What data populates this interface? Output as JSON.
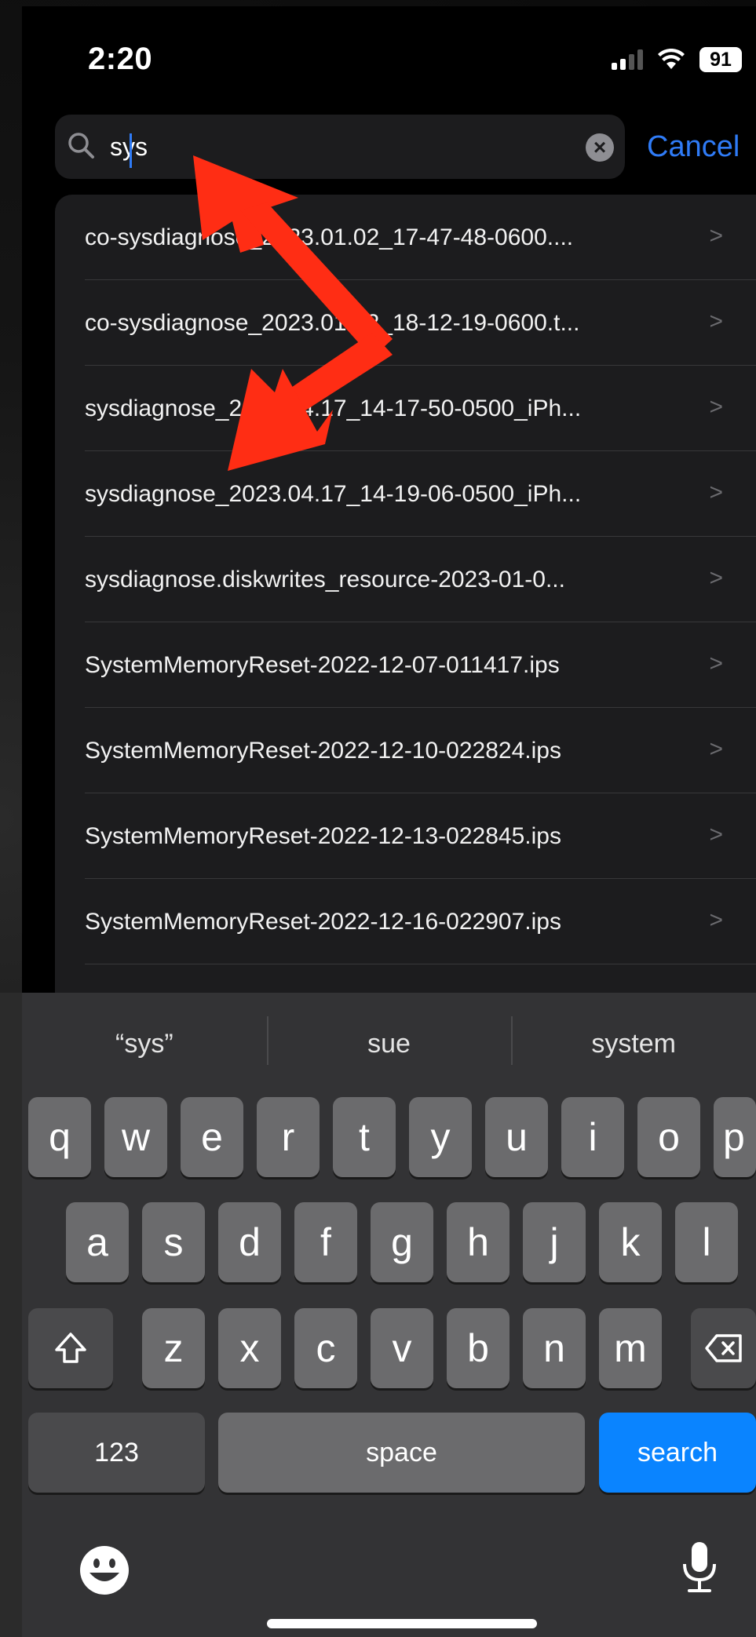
{
  "status_bar": {
    "time": "2:20",
    "battery": "91"
  },
  "search": {
    "value": "sys",
    "cancel_label": "Cancel"
  },
  "results": [
    "co-sysdiagnose_2023.01.02_17-47-48-0600....",
    "co-sysdiagnose_2023.01.02_18-12-19-0600.t...",
    "sysdiagnose_2023.04.17_14-17-50-0500_iPh...",
    "sysdiagnose_2023.04.17_14-19-06-0500_iPh...",
    "sysdiagnose.diskwrites_resource-2023-01-0...",
    "SystemMemoryReset-2022-12-07-011417.ips",
    "SystemMemoryReset-2022-12-10-022824.ips",
    "SystemMemoryReset-2022-12-13-022845.ips",
    "SystemMemoryReset-2022-12-16-022907.ips"
  ],
  "keyboard": {
    "suggestions": [
      "“sys”",
      "sue",
      "system"
    ],
    "row1": [
      "q",
      "w",
      "e",
      "r",
      "t",
      "y",
      "u",
      "i",
      "o",
      "p"
    ],
    "row2": [
      "a",
      "s",
      "d",
      "f",
      "g",
      "h",
      "j",
      "k",
      "l"
    ],
    "row3": [
      "z",
      "x",
      "c",
      "v",
      "b",
      "n",
      "m"
    ],
    "numbers_label": "123",
    "space_label": "space",
    "search_label": "search"
  },
  "colors": {
    "accent": "#0a84ff",
    "annotation_arrow": "#ff2d14"
  },
  "icons": {
    "search": "magnifier-icon",
    "clear": "clear-circle-icon",
    "shift": "shift-icon",
    "backspace": "backspace-icon",
    "emoji": "emoji-icon",
    "dictation": "microphone-icon"
  }
}
